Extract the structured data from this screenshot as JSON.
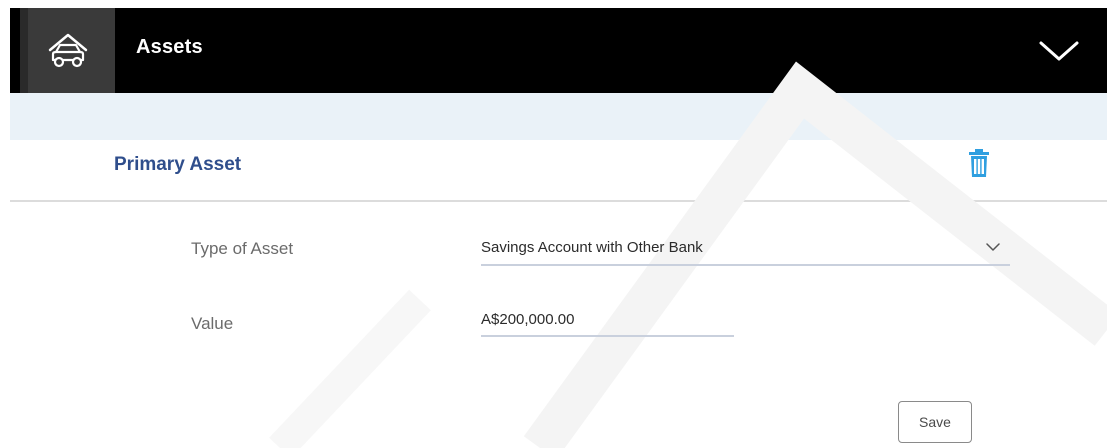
{
  "header": {
    "title": "Assets",
    "home_icon": "home-car-icon",
    "collapse_icon": "chevron-down-icon"
  },
  "section": {
    "title": "Primary Asset",
    "delete_icon": "trash-icon"
  },
  "form": {
    "type_of_asset": {
      "label": "Type of Asset",
      "value": "Savings Account with Other Bank"
    },
    "value": {
      "label": "Value",
      "value": "A$200,000.00"
    },
    "save_label": "Save"
  },
  "colors": {
    "header_bg": "#000000",
    "home_tile_bg": "#3a3a3a",
    "section_title": "#2f4e8c",
    "trash_icon": "#2f9fe0",
    "light_band": "#eaf2f8"
  }
}
